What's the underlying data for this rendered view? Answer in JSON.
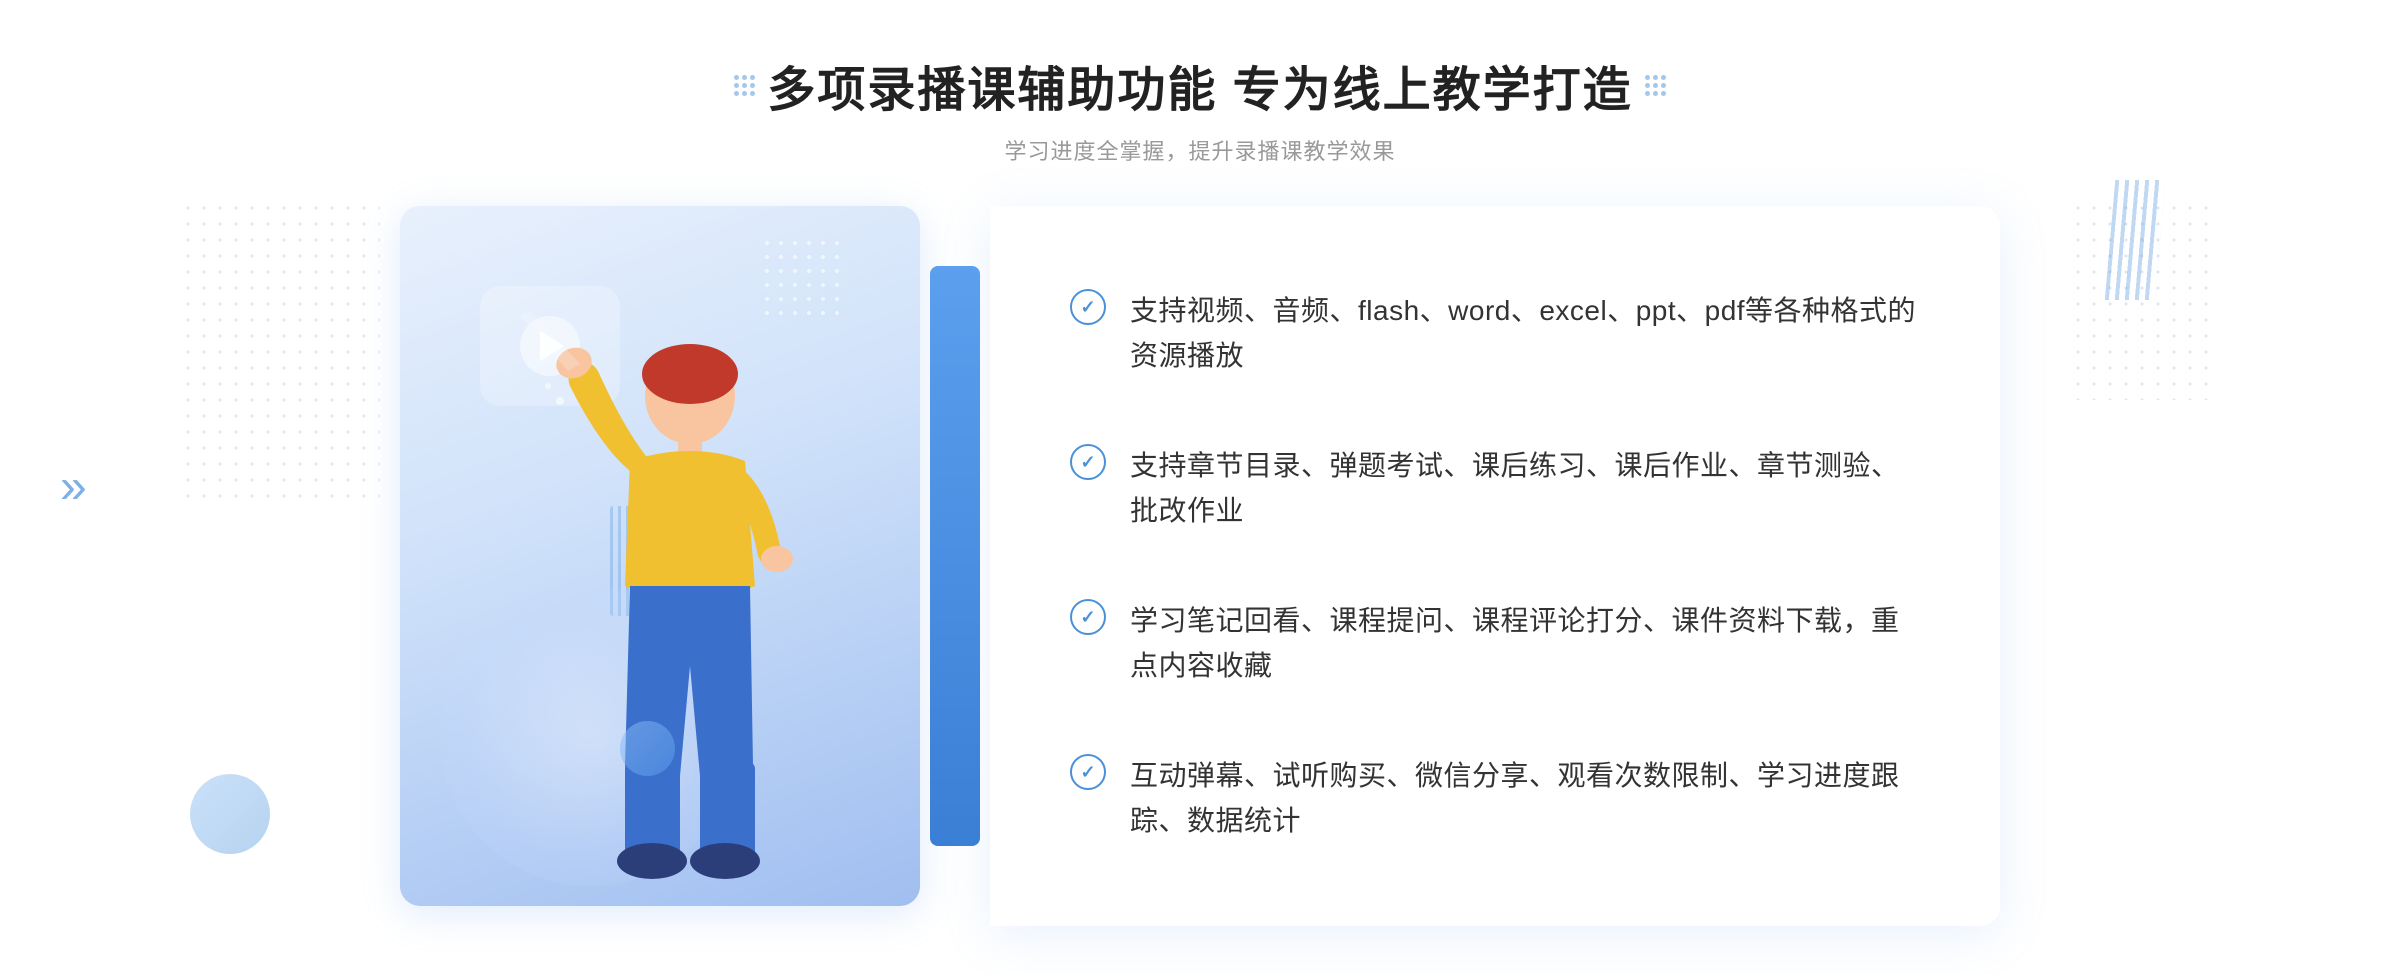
{
  "header": {
    "title": "多项录播课辅助功能 专为线上教学打造",
    "subtitle": "学习进度全掌握，提升录播课教学效果",
    "title_dots_left": "dots-grid-icon",
    "title_dots_right": "dots-grid-icon"
  },
  "features": [
    {
      "id": 1,
      "text": "支持视频、音频、flash、word、excel、ppt、pdf等各种格式的资源播放"
    },
    {
      "id": 2,
      "text": "支持章节目录、弹题考试、课后练习、课后作业、章节测验、批改作业"
    },
    {
      "id": 3,
      "text": "学习笔记回看、课程提问、课程评论打分、课件资料下载，重点内容收藏"
    },
    {
      "id": 4,
      "text": "互动弹幕、试听购买、微信分享、观看次数限制、学习进度跟踪、数据统计"
    }
  ],
  "illustration": {
    "play_icon": "play-triangle-icon"
  },
  "decorative": {
    "chevron": "»",
    "accent_color": "#4a90d9"
  }
}
